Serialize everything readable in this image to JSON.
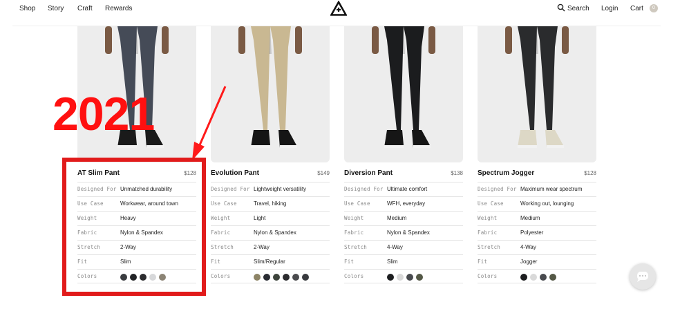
{
  "header": {
    "nav": {
      "shop": "Shop",
      "story": "Story",
      "craft": "Craft",
      "rewards": "Rewards"
    },
    "search": "Search",
    "login": "Login",
    "cart": "Cart",
    "cart_count": "0"
  },
  "annotation": {
    "year": "2021",
    "color": "#e11b1b"
  },
  "spec_labels": {
    "designed_for": "Designed For",
    "use_case": "Use Case",
    "weight": "Weight",
    "fabric": "Fabric",
    "stretch": "Stretch",
    "fit": "Fit",
    "colors": "Colors"
  },
  "products": [
    {
      "name": "AT Slim Pant",
      "price": "$128",
      "designed_for": "Unmatched durability",
      "use_case": "Workwear, around town",
      "weight": "Heavy",
      "fabric": "Nylon & Spandex",
      "stretch": "2-Way",
      "fit": "Slim",
      "colors": [
        "#3a3c40",
        "#222326",
        "#2c2d2f",
        "#d7d8da",
        "#8c8475"
      ]
    },
    {
      "name": "Evolution Pant",
      "price": "$149",
      "designed_for": "Lightweight versatility",
      "use_case": "Travel, hiking",
      "weight": "Light",
      "fabric": "Nylon & Spandex",
      "stretch": "2-Way",
      "fit": "Slim/Regular",
      "colors": [
        "#8d8466",
        "#2a2c33",
        "#3d443c",
        "#2b2c2e",
        "#4a4b4e",
        "#383a3e"
      ]
    },
    {
      "name": "Diversion Pant",
      "price": "$138",
      "designed_for": "Ultimate comfort",
      "use_case": "WFH, everyday",
      "weight": "Medium",
      "fabric": "Nylon & Spandex",
      "stretch": "4-Way",
      "fit": "Slim",
      "colors": [
        "#1d1e20",
        "#d9d9d9",
        "#494b4f",
        "#545846"
      ]
    },
    {
      "name": "Spectrum Jogger",
      "price": "$128",
      "designed_for": "Maximum wear spectrum",
      "use_case": "Working out, lounging",
      "weight": "Medium",
      "fabric": "Polyester",
      "stretch": "4-Way",
      "fit": "Jogger",
      "colors": [
        "#1d1e20",
        "#d9d9d9",
        "#494b4f",
        "#545846"
      ]
    }
  ]
}
